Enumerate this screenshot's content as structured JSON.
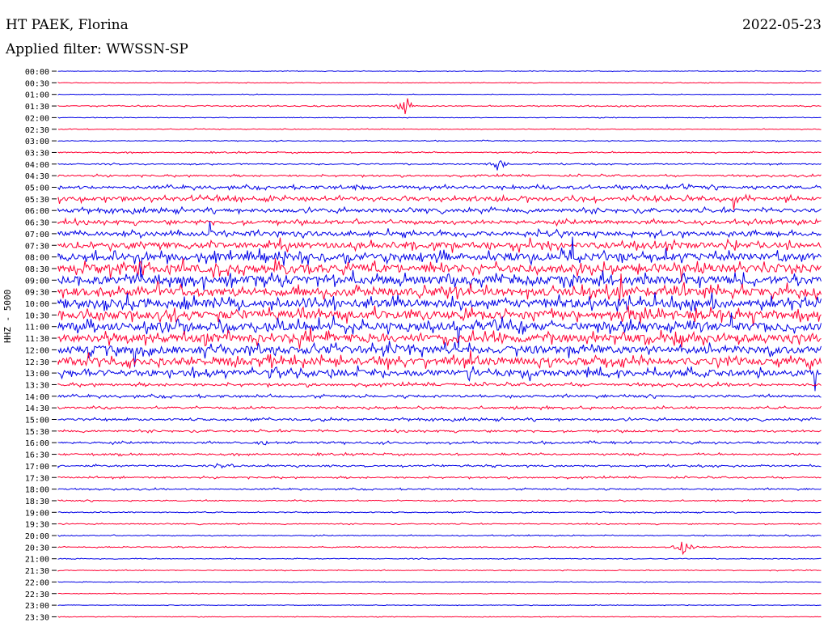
{
  "header": {
    "station": "HT PAEK, Florina",
    "date": "2022-05-23",
    "filter": "Applied filter: WWSSN-SP"
  },
  "chart_data": {
    "type": "seismogram",
    "channel_label": "HHZ - 5000",
    "row_labels": [
      "00:00",
      "00:30",
      "01:00",
      "01:30",
      "02:00",
      "02:30",
      "03:00",
      "03:30",
      "04:00",
      "04:30",
      "05:00",
      "05:30",
      "06:00",
      "06:30",
      "07:00",
      "07:30",
      "08:00",
      "08:30",
      "09:00",
      "09:30",
      "10:00",
      "10:30",
      "11:00",
      "11:30",
      "12:00",
      "12:30",
      "13:00",
      "13:30",
      "14:00",
      "14:30",
      "15:00",
      "15:30",
      "16:00",
      "16:30",
      "17:00",
      "17:30",
      "18:00",
      "18:30",
      "19:00",
      "19:30",
      "20:00",
      "20:30",
      "21:00",
      "21:30",
      "22:00",
      "22:30",
      "23:00",
      "23:30"
    ],
    "trace_colors": [
      "#0000e6",
      "#ff0033"
    ],
    "noise_level": [
      0.3,
      0.3,
      0.3,
      0.5,
      0.3,
      0.4,
      0.4,
      0.6,
      0.6,
      0.9,
      1.6,
      2.2,
      2.0,
      2.0,
      2.4,
      3.2,
      4.0,
      4.5,
      4.5,
      4.5,
      4.5,
      4.5,
      4.5,
      4.5,
      4.3,
      4.0,
      3.5,
      1.4,
      1.2,
      1.1,
      1.1,
      1.0,
      1.0,
      0.9,
      0.9,
      0.8,
      0.7,
      0.6,
      0.5,
      0.5,
      0.5,
      0.5,
      0.4,
      0.4,
      0.3,
      0.3,
      0.3,
      0.3
    ],
    "events": [
      {
        "row": 3,
        "pos": 0.455,
        "amp": 14
      },
      {
        "row": 8,
        "pos": 0.575,
        "amp": 8
      },
      {
        "row": 41,
        "pos": 0.82,
        "amp": 12
      },
      {
        "row": 34,
        "pos": 0.22,
        "amp": 5
      },
      {
        "row": 32,
        "pos": 0.27,
        "amp": 4
      },
      {
        "row": 10,
        "pos": 0.39,
        "amp": 5
      },
      {
        "row": 10,
        "pos": 0.82,
        "amp": 6
      }
    ]
  }
}
